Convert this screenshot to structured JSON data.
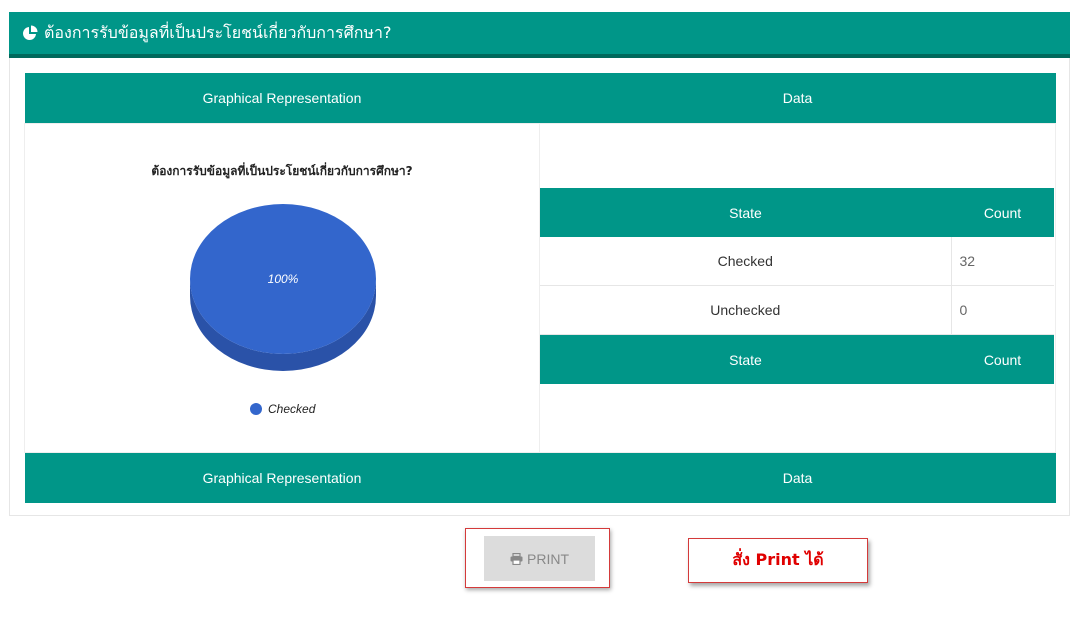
{
  "panel": {
    "title": "ต้องการรับข้อมูลที่เป็นประโยชน์เกี่ยวกับการศึกษา?",
    "icon": "pie-chart-icon",
    "header_color": "#009688"
  },
  "outer_table": {
    "header_left": "Graphical Representation",
    "header_right": "Data",
    "footer_left": "Graphical Representation",
    "footer_right": "Data"
  },
  "data_table": {
    "columns": [
      "State",
      "Count"
    ],
    "rows": [
      {
        "state": "Checked",
        "count": "32"
      },
      {
        "state": "Unchecked",
        "count": "0"
      }
    ],
    "footer_columns": [
      "State",
      "Count"
    ]
  },
  "chart_data": {
    "type": "pie",
    "title": "ต้องการรับข้อมูลที่เป็นประโยชน์เกี่ยวกับการศึกษา?",
    "labels": [
      "Checked",
      "Unchecked"
    ],
    "values": [
      32,
      0
    ],
    "slice_labels": [
      "100%"
    ],
    "colors": [
      "#3366cc"
    ],
    "legend": [
      "Checked"
    ],
    "legend_position": "bottom",
    "style": "3d"
  },
  "print_button": {
    "label": "PRINT",
    "icon": "printer-icon"
  },
  "note": {
    "text": "สั่ง Print ได้"
  }
}
